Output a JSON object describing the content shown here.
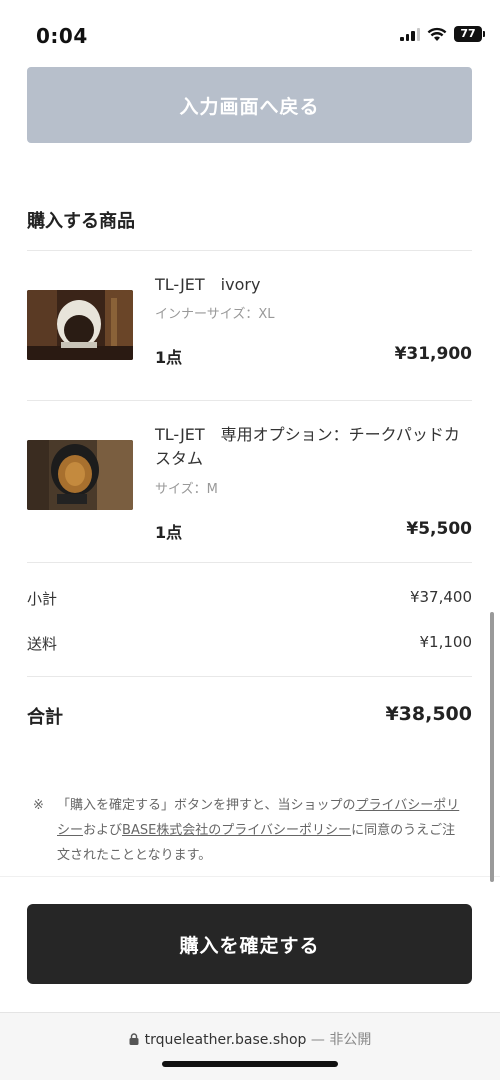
{
  "status_bar": {
    "time": "0:04",
    "battery": "77"
  },
  "back_button": {
    "label": "入力画面へ戻る"
  },
  "section": {
    "title": "購入する商品"
  },
  "items": [
    {
      "name": "TL-JET　ivory",
      "variant": "インナーサイズ：XL",
      "qty": "1点",
      "price": "¥31,900"
    },
    {
      "name": "TL-JET　専用オプション：チークパッドカスタム",
      "variant": "サイズ：M",
      "qty": "1点",
      "price": "¥5,500"
    }
  ],
  "summary": {
    "subtotal_label": "小計",
    "subtotal_value": "¥37,400",
    "shipping_label": "送料",
    "shipping_value": "¥1,100",
    "total_label": "合計",
    "total_value": "¥38,500"
  },
  "notice": {
    "mark": "※",
    "text_1": "「購入を確定する」ボタンを押すと、当ショップの",
    "link_1": "プライバシーポリシー",
    "text_2": "および",
    "link_2": "BASE株式会社のプライバシーポリシー",
    "text_3": "に同意のうえご注文されたこととなります。"
  },
  "confirm_button": {
    "label": "購入を確定する"
  },
  "browser": {
    "url": "trqueleather.base.shop",
    "separator": " — ",
    "visibility": "非公開"
  }
}
